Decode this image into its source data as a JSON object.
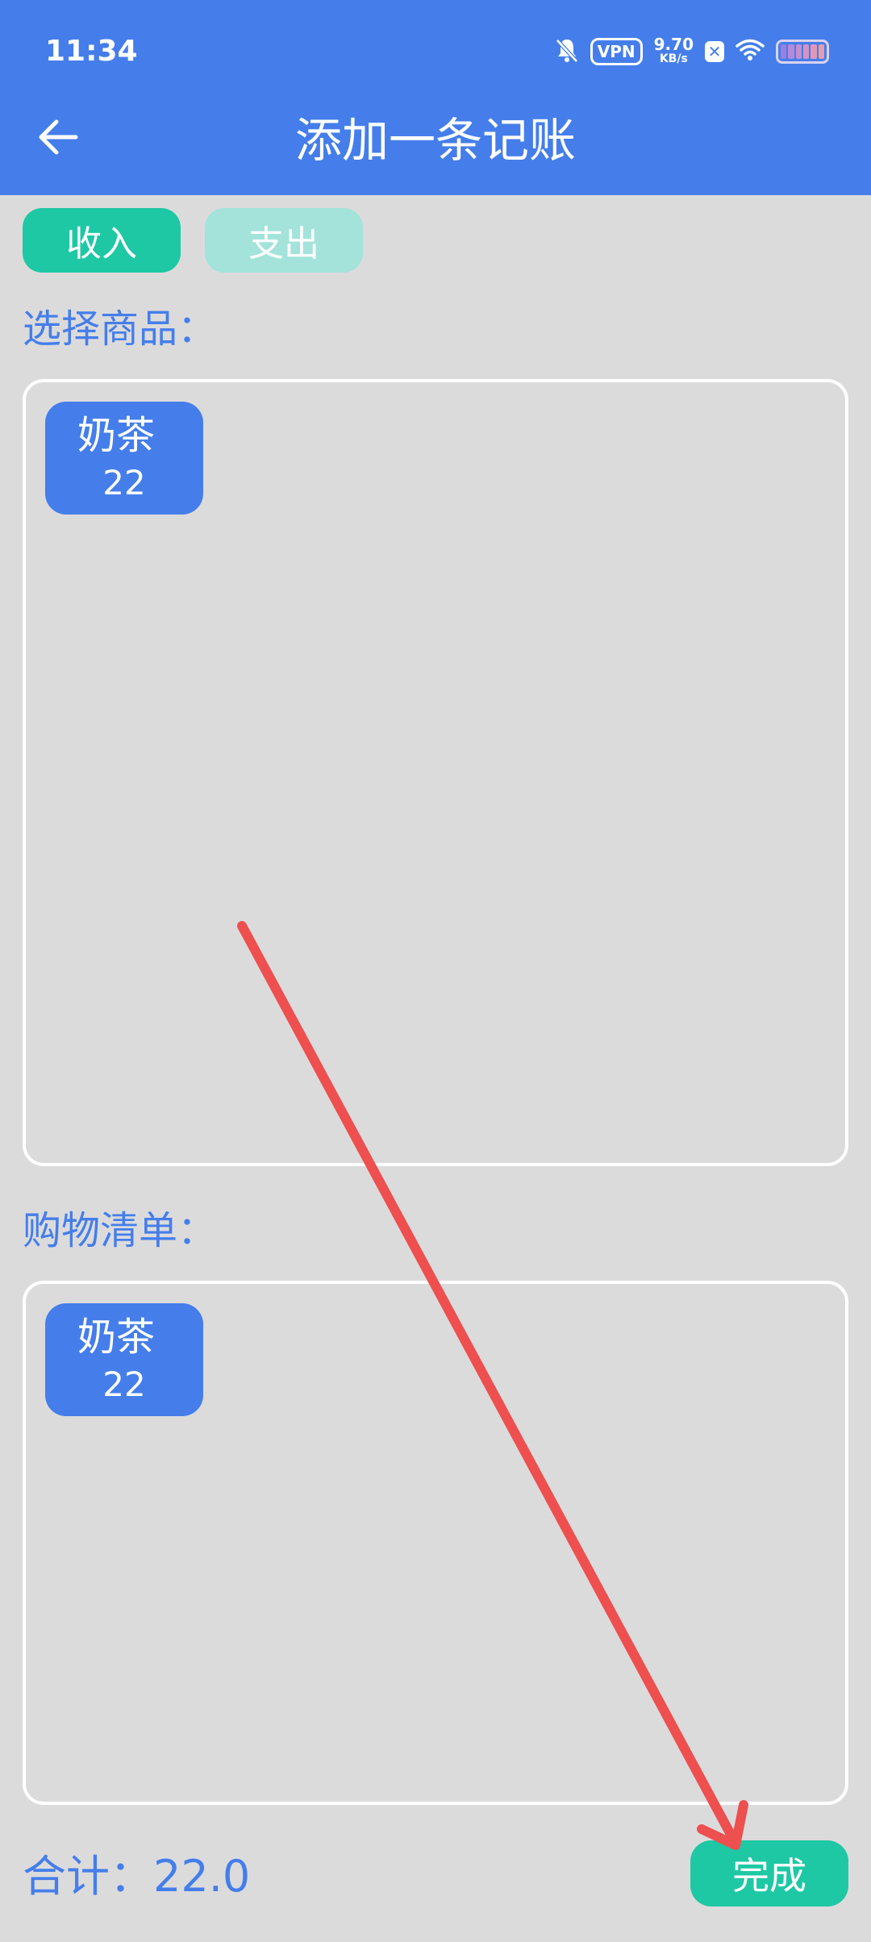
{
  "status_bar": {
    "time": "11:34",
    "vpn": "VPN",
    "speed_value": "9.70",
    "speed_unit": "KB/s",
    "x_badge": "✕",
    "icons": [
      "bell-off-icon",
      "wifi-icon",
      "battery-icon"
    ]
  },
  "header": {
    "title": "添加一条记账",
    "back_icon": "arrow-left-icon"
  },
  "type_toggle": {
    "income_label": "收入",
    "expense_label": "支出"
  },
  "select_section": {
    "label": "选择商品：",
    "items": [
      {
        "name": "奶茶",
        "price": "22"
      }
    ]
  },
  "cart_section": {
    "label": "购物清单：",
    "items": [
      {
        "name": "奶茶",
        "price": "22"
      }
    ]
  },
  "footer": {
    "total_label": "合计：",
    "total_value": "22.0",
    "done_label": "完成"
  },
  "colors": {
    "primary_blue": "#457eea",
    "accent_green": "#1ec8a4",
    "light_green": "#a3e3da",
    "background": "#dcdbdc",
    "annotation_red": "#ee4f4f"
  }
}
